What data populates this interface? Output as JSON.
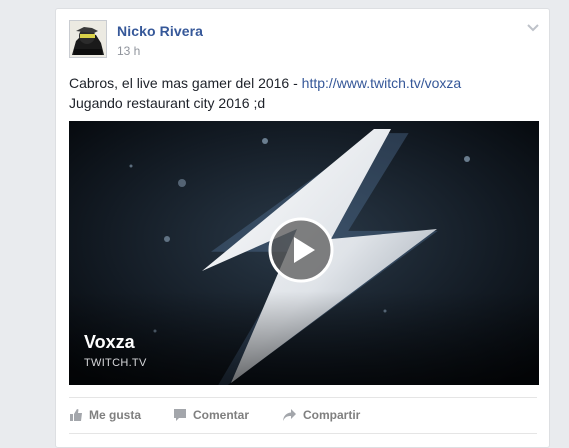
{
  "post": {
    "author": "Nicko Rivera",
    "time": "13 h",
    "text_prefix": "Cabros, el live mas gamer del 2016 - ",
    "link": "http://www.twitch.tv/voxza",
    "text_line2": "Jugando restaurant city 2016 ;d"
  },
  "media": {
    "title": "Voxza",
    "domain": "TWITCH.TV"
  },
  "actions": {
    "like": "Me gusta",
    "comment": "Comentar",
    "share": "Compartir"
  },
  "colors": {
    "link": "#365899",
    "background": "#e9ebee",
    "action_text": "#7f7f7f"
  },
  "icons": [
    "chevron-down-icon",
    "play-icon",
    "thumbs-up-icon",
    "comment-icon",
    "share-icon",
    "lightning-bolt-icon"
  ]
}
